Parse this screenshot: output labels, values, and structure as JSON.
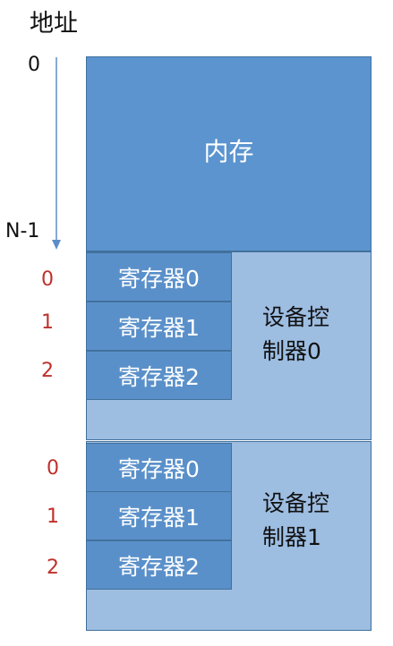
{
  "header": {
    "title": "地址"
  },
  "address_axis": {
    "start_label": "0",
    "end_label": "N-1"
  },
  "memory": {
    "label": "内存"
  },
  "controllers": [
    {
      "label_line1": "设备控",
      "label_line2": "制器0",
      "offsets": [
        "0",
        "1",
        "2"
      ],
      "registers": [
        "寄存器0",
        "寄存器1",
        "寄存器2"
      ]
    },
    {
      "label_line1": "设备控",
      "label_line2": "制器1",
      "offsets": [
        "0",
        "1",
        "2"
      ],
      "registers": [
        "寄存器0",
        "寄存器1",
        "寄存器2"
      ]
    }
  ],
  "colors": {
    "memory_fill": "#5b94cf",
    "controller_fill": "#9dbde1",
    "register_fill": "#5a90ca",
    "offset_text": "#c0302b",
    "arrow": "#5b8ec9"
  }
}
